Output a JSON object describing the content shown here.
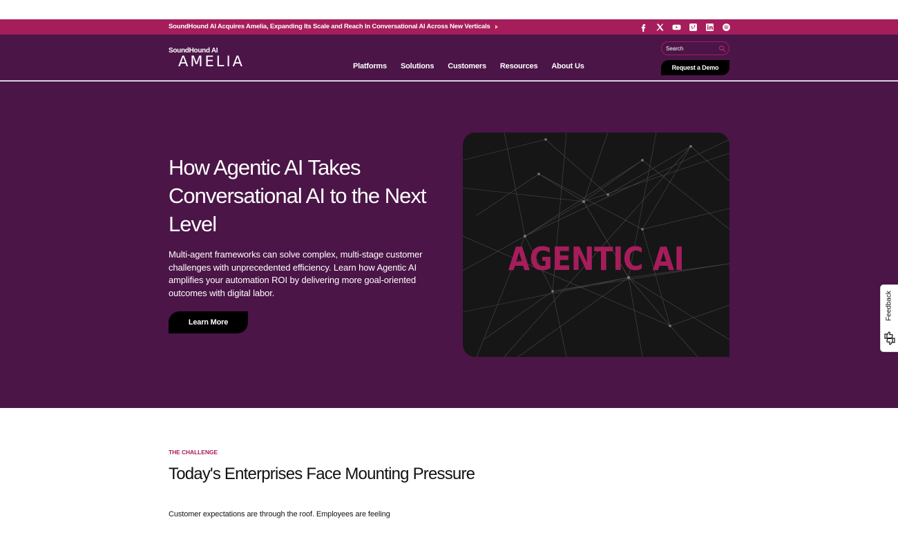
{
  "announcement": {
    "text": "SoundHound AI Acquires Amelia, Expanding Its Scale and Reach In Conversational AI Across New Verticals"
  },
  "socials": [
    {
      "name": "facebook-icon",
      "glyph": "f"
    },
    {
      "name": "x-icon",
      "glyph": "𝕏"
    },
    {
      "name": "youtube-icon",
      "glyph": ""
    },
    {
      "name": "vimeo-icon",
      "glyph": ""
    },
    {
      "name": "linkedin-icon",
      "glyph": ""
    },
    {
      "name": "spotify-icon",
      "glyph": ""
    }
  ],
  "header": {
    "logo_top": "SoundHound AI",
    "logo_main": "AMELIA",
    "nav": [
      "Platforms",
      "Solutions",
      "Customers",
      "Resources",
      "About Us"
    ],
    "search_placeholder": "Search",
    "demo_label": "Request a Demo"
  },
  "hero": {
    "title": "How Agentic AI Takes Conversational AI to the Next Level",
    "description": "Multi-agent frameworks can solve complex, multi-stage customer challenges with unprecedented efficiency. Learn how Agentic AI amplifies your automation ROI by delivering more goal-oriented outcomes with digital labor.",
    "cta_label": "Learn More",
    "image_text": "AGENTIC AI"
  },
  "feedback": {
    "label": "Feedback"
  },
  "challenge": {
    "eyebrow": "THE CHALLENGE",
    "title": "Today's Enterprises Face Mounting Pressure",
    "body": "Customer expectations are through the roof. Employees are feeling"
  },
  "colors": {
    "brand_purple": "#4b1548",
    "brand_magenta": "#a61d5b",
    "button_black": "#000000"
  }
}
